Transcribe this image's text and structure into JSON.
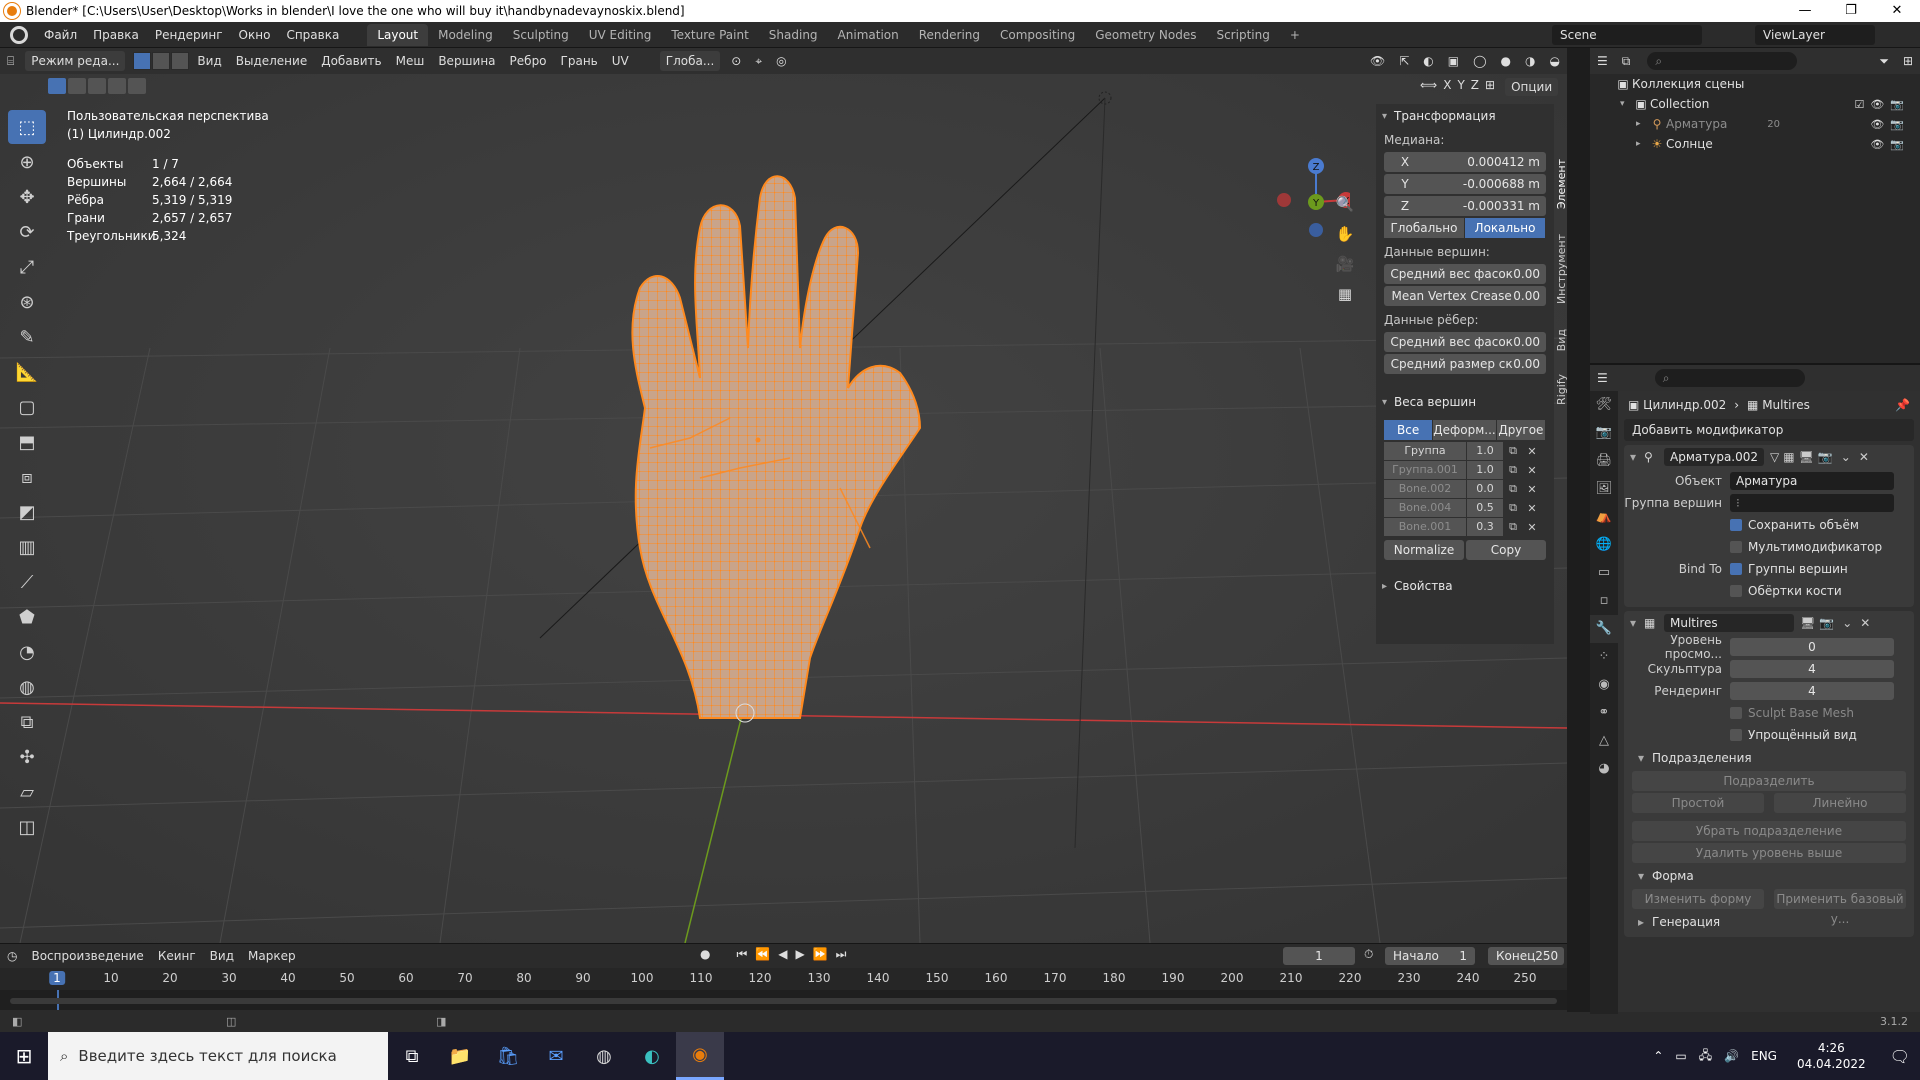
{
  "window": {
    "title": "Blender* [C:\\Users\\User\\Desktop\\Works in blender\\I love the one who will buy it\\handbynadevaynoskix.blend]",
    "controls": [
      "—",
      "❐",
      "✕"
    ]
  },
  "topbar": {
    "menus": [
      "Файл",
      "Правка",
      "Рендеринг",
      "Окно",
      "Справка"
    ],
    "workspaces": [
      "Layout",
      "Modeling",
      "Sculpting",
      "UV Editing",
      "Texture Paint",
      "Shading",
      "Animation",
      "Rendering",
      "Compositing",
      "Geometry Nodes",
      "Scripting",
      "+"
    ],
    "active_workspace": "Layout",
    "scene": "Scene",
    "view_layer": "ViewLayer"
  },
  "viewport_header": {
    "mode": "Режим реда...",
    "menus": [
      "Вид",
      "Выделение",
      "Добавить",
      "Меш",
      "Вершина",
      "Ребро",
      "Грань",
      "UV"
    ],
    "orientation": "Глоба...",
    "options": "Опции",
    "axis_x": "X",
    "axis_y": "Y",
    "axis_z": "Z"
  },
  "viewport_info": {
    "view": "Пользовательская перспектива",
    "object": "(1) Цилиндр.002",
    "stats": [
      {
        "label": "Объекты",
        "value": "1 / 7"
      },
      {
        "label": "Вершины",
        "value": "2,664 / 2,664"
      },
      {
        "label": "Рёбра",
        "value": "5,319 / 5,319"
      },
      {
        "label": "Грани",
        "value": "2,657 / 2,657"
      },
      {
        "label": "Треугольники",
        "value": "5,324"
      }
    ]
  },
  "tools": [
    "select-box",
    "cursor",
    "move",
    "rotate",
    "scale",
    "transform",
    "annotate",
    "measure",
    "add-cube",
    "extrude",
    "inset",
    "bevel",
    "loop-cut",
    "knife",
    "poly-build",
    "spin",
    "smooth",
    "edge-slide",
    "shrink-fatten",
    "shear",
    "rip"
  ],
  "gizmo": {
    "z_label": "Z",
    "y_label": "Y",
    "x_label": "X"
  },
  "npanel": {
    "transform_title": "Трансформация",
    "median_label": "Медиана:",
    "x": {
      "k": "X",
      "v": "0.000412 m"
    },
    "y": {
      "k": "Y",
      "v": "-0.000688 m"
    },
    "z": {
      "k": "Z",
      "v": "-0.000331 m"
    },
    "global": "Глобально",
    "local": "Локально",
    "vertex_data_label": "Данные вершин:",
    "vertex_bevel": {
      "k": "Средний вес фасок",
      "v": "0.00"
    },
    "vertex_crease": {
      "k": "Mean Vertex Crease",
      "v": "0.00"
    },
    "edge_data_label": "Данные рёбер:",
    "edge_bevel": {
      "k": "Средний вес фасок",
      "v": "0.00"
    },
    "edge_crease": {
      "k": "Средний размер ск",
      "v": "0.00"
    },
    "weights_title": "Веса вершин",
    "weight_tabs": [
      "Все",
      "Деформ...",
      "Другое"
    ],
    "weights": [
      {
        "name": "Группа",
        "value": "1.0",
        "dim": false
      },
      {
        "name": "Группа.001",
        "value": "1.0",
        "dim": true
      },
      {
        "name": "Bone.002",
        "value": "0.0",
        "dim": true
      },
      {
        "name": "Bone.004",
        "value": "0.5",
        "dim": true
      },
      {
        "name": "Bone.001",
        "value": "0.3",
        "dim": true
      }
    ],
    "normalize": "Normalize",
    "copy": "Copy",
    "properties_title": "Свойства",
    "tabs": [
      "Элемент",
      "Инструмент",
      "Вид",
      "Rigify"
    ]
  },
  "timeline": {
    "menus": [
      "Воспроизведение",
      "Кеинг",
      "Вид",
      "Маркер"
    ],
    "current_frame": "1",
    "start_label": "Начало",
    "start": "1",
    "end_label": "Конец",
    "end": "250",
    "ruler": [
      "1",
      "10",
      "20",
      "30",
      "40",
      "50",
      "60",
      "70",
      "80",
      "90",
      "100",
      "110",
      "120",
      "130",
      "140",
      "150",
      "160",
      "170",
      "180",
      "190",
      "200",
      "210",
      "220",
      "230",
      "240",
      "250"
    ]
  },
  "status": {
    "version": "3.1.2"
  },
  "outliner": {
    "root": "Коллекция сцены",
    "items": [
      {
        "name": "Collection",
        "indent": 1
      },
      {
        "name": "Арматура",
        "indent": 2,
        "extra": "20"
      },
      {
        "name": "Солнце",
        "indent": 2
      }
    ]
  },
  "properties": {
    "breadcrumb_obj": "Цилиндр.002",
    "breadcrumb_mod": "Multires",
    "add_modifier": "Добавить модификатор",
    "armature_mod": {
      "name": "Арматура.002",
      "object_label": "Объект",
      "object_value": "Арматура",
      "vgroup_label": "Группа вершин",
      "preserve_volume": "Сохранить объём",
      "multi_modifier": "Мультимодификатор",
      "bind_to_label": "Bind To",
      "vertex_groups": "Группы вершин",
      "bone_envelopes": "Обёртки кости"
    },
    "multires_mod": {
      "name": "Multires",
      "viewport_label": "Уровень просмо...",
      "viewport_value": "0",
      "sculpt_label": "Скульптура",
      "sculpt_value": "4",
      "render_label": "Рендеринг",
      "render_value": "4",
      "sculpt_base_mesh": "Sculpt Base Mesh",
      "optimal_display": "Упрощённый вид",
      "subdivisions_title": "Подразделения",
      "subdivide": "Подразделить",
      "simple": "Простой",
      "linear": "Линейно",
      "unsubdivide": "Убрать подразделение",
      "delete_higher": "Удалить уровень выше",
      "shape_title": "Форма",
      "reshape": "Изменить форму",
      "apply_base": "Применить базовый у...",
      "generate_title": "Генерация"
    }
  },
  "taskbar": {
    "search_placeholder": "Введите здесь текст для поиска",
    "lang": "ENG",
    "time": "4:26",
    "date": "04.04.2022"
  },
  "colors": {
    "accent": "#4772b3",
    "selection": "#ff8a1f",
    "x_axis": "#c73a3a",
    "y_axis": "#6c9a1d"
  }
}
